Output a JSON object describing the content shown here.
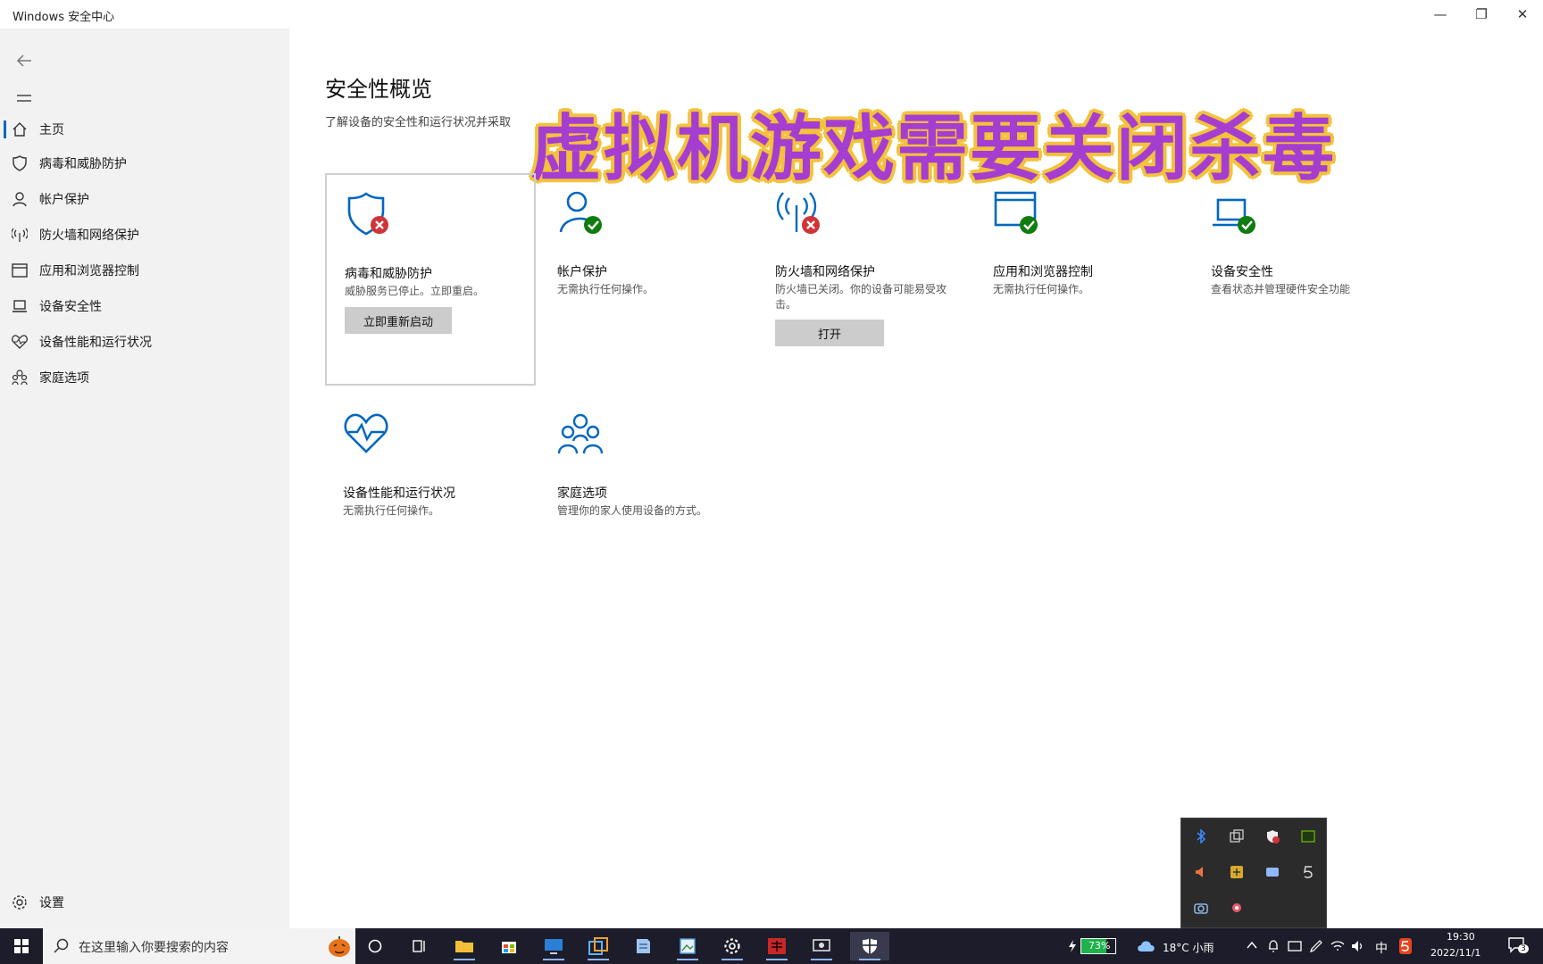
{
  "window": {
    "title": "Windows 安全中心",
    "controls": {
      "minimize": "—",
      "restore": "❐",
      "close": "✕"
    }
  },
  "sidebar": {
    "back_icon": "back-arrow-icon",
    "menu_icon": "hamburger-icon",
    "items": [
      {
        "label": "主页",
        "icon": "home-icon"
      },
      {
        "label": "病毒和威胁防护",
        "icon": "shield-icon"
      },
      {
        "label": "帐户保护",
        "icon": "person-icon"
      },
      {
        "label": "防火墙和网络保护",
        "icon": "antenna-icon"
      },
      {
        "label": "应用和浏览器控制",
        "icon": "browser-window-icon"
      },
      {
        "label": "设备安全性",
        "icon": "laptop-icon"
      },
      {
        "label": "设备性能和运行状况",
        "icon": "heart-icon"
      },
      {
        "label": "家庭选项",
        "icon": "family-icon"
      }
    ],
    "settings_label": "设置"
  },
  "main": {
    "title": "安全性概览",
    "subtitle": "了解设备的安全性和运行状况并采取",
    "overlay_text": "虚拟机游戏需要关闭杀毒",
    "tiles": [
      {
        "title": "病毒和威胁防护",
        "desc": "威胁服务已停止。立即重启。",
        "status": "error",
        "button": "立即重新启动"
      },
      {
        "title": "帐户保护",
        "desc": "无需执行任何操作。",
        "status": "ok"
      },
      {
        "title": "防火墙和网络保护",
        "desc": "防火墙已关闭。你的设备可能易受攻击。",
        "status": "error",
        "button": "打开"
      },
      {
        "title": "应用和浏览器控制",
        "desc": "无需执行任何操作。",
        "status": "ok"
      },
      {
        "title": "设备安全性",
        "desc": "查看状态并管理硬件安全功能",
        "status": "ok"
      },
      {
        "title": "设备性能和运行状况",
        "desc": "无需执行任何操作。"
      },
      {
        "title": "家庭选项",
        "desc": "管理你的家人使用设备的方式。"
      }
    ]
  },
  "taskbar": {
    "search_placeholder": "在这里输入你要搜索的内容",
    "battery": "73%",
    "weather": "18°C 小雨",
    "ime": "中",
    "time": "19:30",
    "date": "2022/11/1",
    "notifications": "3"
  },
  "colors": {
    "accent": "#0067c0",
    "ok": "#107c10",
    "error": "#d13438",
    "overlay_fill": "#a53dd0",
    "overlay_outline": "#f3c23a"
  }
}
